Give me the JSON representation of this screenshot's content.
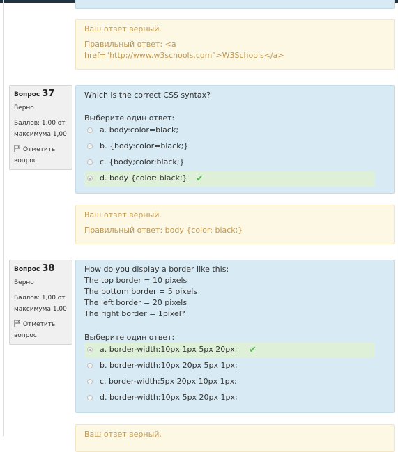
{
  "prev_feedback": {
    "line1": "Ваш ответ верный.",
    "line2": "Правильный ответ: <a",
    "line3": "href=\"http://www.w3schools.com\">W3Schools</a>"
  },
  "q37": {
    "label": "Вопрос",
    "number": "37",
    "state": "Верно",
    "grade_line1": "Баллов: 1,00 от",
    "grade_line2": "максимума 1,00",
    "flag_line1": "Отметить",
    "flag_line2": "вопрос",
    "text": "Which is the correct CSS syntax?",
    "prompt": "Выберите один ответ:",
    "answers": [
      {
        "text": "a. body:color=black;",
        "selected": false
      },
      {
        "text": "b. {body:color=black;}",
        "selected": false
      },
      {
        "text": "c. {body;color:black;}",
        "selected": false
      },
      {
        "text": "d. body {color: black;}",
        "selected": true
      }
    ],
    "feedback_line1": "Ваш ответ верный.",
    "feedback_line2": "Правильный ответ: body {color: black;}"
  },
  "q38": {
    "label": "Вопрос",
    "number": "38",
    "state": "Верно",
    "grade_line1": "Баллов: 1,00 от",
    "grade_line2": "максимума 1,00",
    "flag_line1": "Отметить",
    "flag_line2": "вопрос",
    "text_lines": [
      "How do you display a border like this:",
      "The top border = 10 pixels",
      "The bottom border = 5 pixels",
      "The left border = 20 pixels",
      "The right border = 1pixel?"
    ],
    "prompt": "Выберите один ответ:",
    "answers": [
      {
        "text": "a. border-width:10px 1px 5px 20px;",
        "selected": true
      },
      {
        "text": "b. border-width:10px 20px 5px 1px;",
        "selected": false
      },
      {
        "text": "c. border-width:5px 20px 10px 1px;",
        "selected": false
      },
      {
        "text": "d. border-width:10px 5px 20px 1px;",
        "selected": false
      }
    ],
    "feedback_line1": "Ваш ответ верный."
  },
  "icons": {
    "flag": "flag-icon",
    "check": "check-icon",
    "correct_color": "#5bb75b"
  }
}
